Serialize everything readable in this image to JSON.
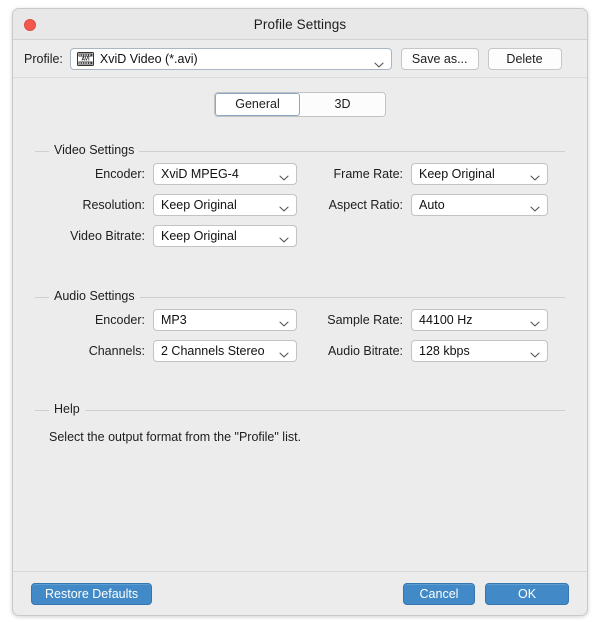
{
  "window": {
    "title": "Profile Settings",
    "close_icon": "close-icon",
    "accent_blue": "#4189c7",
    "close_red": "#f3584f"
  },
  "profile_bar": {
    "label": "Profile:",
    "icon": "avi-video-icon",
    "value": "XviD Video (*.avi)",
    "dropdown_icon": "chevron-down-icon",
    "save_as_label": "Save as...",
    "delete_label": "Delete"
  },
  "tabs": [
    {
      "label": "General",
      "active": true
    },
    {
      "label": "3D",
      "active": false
    }
  ],
  "video_settings": {
    "title": "Video Settings",
    "fields": [
      {
        "label": "Encoder:",
        "value": "XviD MPEG-4"
      },
      {
        "label": "Frame Rate:",
        "value": "Keep Original"
      },
      {
        "label": "Resolution:",
        "value": "Keep Original"
      },
      {
        "label": "Aspect Ratio:",
        "value": "Auto"
      },
      {
        "label": "Video Bitrate:",
        "value": "Keep Original"
      }
    ]
  },
  "audio_settings": {
    "title": "Audio Settings",
    "fields": [
      {
        "label": "Encoder:",
        "value": "MP3"
      },
      {
        "label": "Sample Rate:",
        "value": "44100 Hz"
      },
      {
        "label": "Channels:",
        "value": "2 Channels Stereo"
      },
      {
        "label": "Audio Bitrate:",
        "value": "128 kbps"
      }
    ]
  },
  "help": {
    "title": "Help",
    "text": "Select the output format from the \"Profile\" list."
  },
  "footer": {
    "restore_defaults_label": "Restore Defaults",
    "cancel_label": "Cancel",
    "ok_label": "OK"
  }
}
